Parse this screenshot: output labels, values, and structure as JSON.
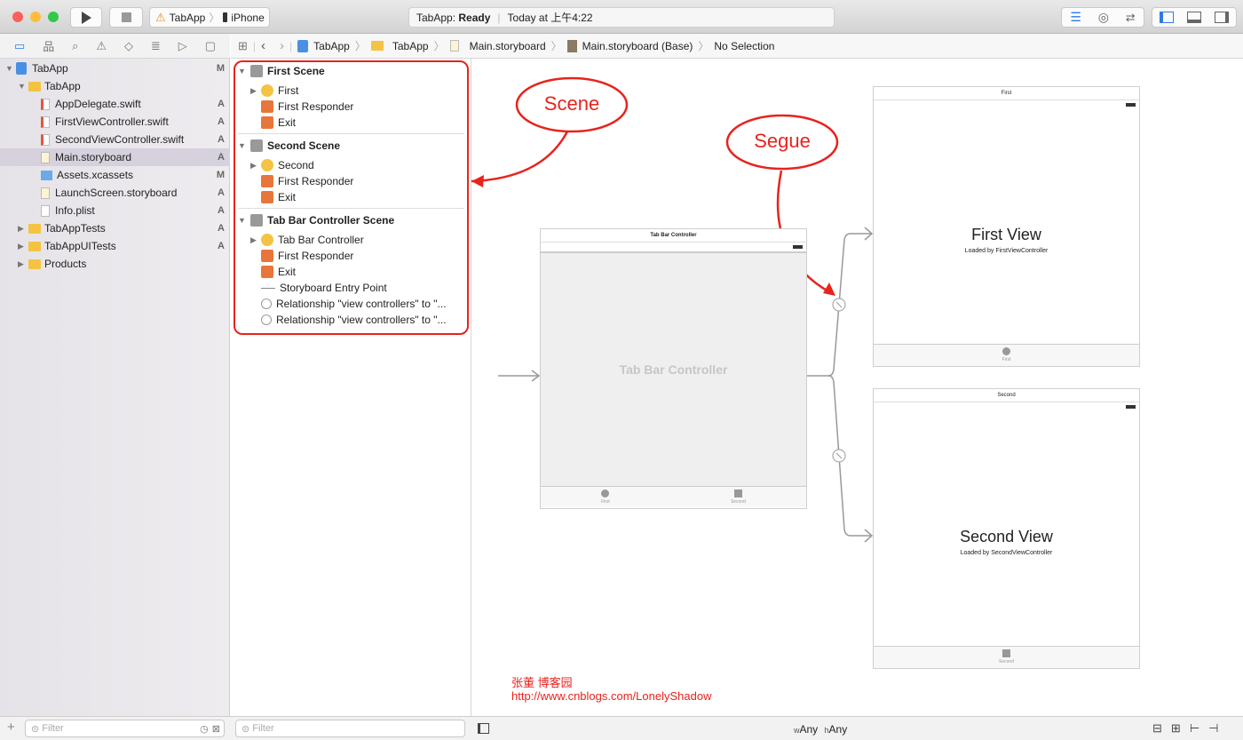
{
  "window": {
    "scheme_app": "TabApp",
    "scheme_device": "iPhone",
    "status_app": "TabApp:",
    "status_state": "Ready",
    "status_time": "Today at 上午4:22"
  },
  "navigator": {
    "tree": [
      {
        "label": "TabApp",
        "status": "M",
        "level": 0,
        "kind": "project",
        "open": true
      },
      {
        "label": "TabApp",
        "status": "",
        "level": 1,
        "kind": "folder",
        "open": true
      },
      {
        "label": "AppDelegate.swift",
        "status": "A",
        "level": 2,
        "kind": "swift"
      },
      {
        "label": "FirstViewController.swift",
        "status": "A",
        "level": 2,
        "kind": "swift"
      },
      {
        "label": "SecondViewController.swift",
        "status": "A",
        "level": 2,
        "kind": "swift"
      },
      {
        "label": "Main.storyboard",
        "status": "A",
        "level": 2,
        "kind": "storyboard",
        "selected": true
      },
      {
        "label": "Assets.xcassets",
        "status": "M",
        "level": 2,
        "kind": "assets"
      },
      {
        "label": "LaunchScreen.storyboard",
        "status": "A",
        "level": 2,
        "kind": "storyboard"
      },
      {
        "label": "Info.plist",
        "status": "A",
        "level": 2,
        "kind": "plist"
      },
      {
        "label": "TabAppTests",
        "status": "A",
        "level": 1,
        "kind": "folder",
        "open": false
      },
      {
        "label": "TabAppUITests",
        "status": "A",
        "level": 1,
        "kind": "folder",
        "open": false
      },
      {
        "label": "Products",
        "status": "",
        "level": 1,
        "kind": "folder",
        "open": false
      }
    ],
    "filter_placeholder": "Filter"
  },
  "jumpbar": [
    "TabApp",
    "TabApp",
    "Main.storyboard",
    "Main.storyboard (Base)",
    "No Selection"
  ],
  "outline": {
    "scenes": [
      {
        "title": "First Scene",
        "items": [
          {
            "label": "First",
            "icon": "view-controller-icon",
            "expand": true
          },
          {
            "label": "First Responder",
            "icon": "first-responder-icon"
          },
          {
            "label": "Exit",
            "icon": "exit-icon"
          }
        ]
      },
      {
        "title": "Second Scene",
        "items": [
          {
            "label": "Second",
            "icon": "view-controller-icon",
            "expand": true
          },
          {
            "label": "First Responder",
            "icon": "first-responder-icon"
          },
          {
            "label": "Exit",
            "icon": "exit-icon"
          }
        ]
      },
      {
        "title": "Tab Bar Controller Scene",
        "items": [
          {
            "label": "Tab Bar Controller",
            "icon": "tab-bar-controller-icon",
            "expand": true
          },
          {
            "label": "First Responder",
            "icon": "first-responder-icon"
          },
          {
            "label": "Exit",
            "icon": "exit-icon"
          },
          {
            "label": "Storyboard Entry Point",
            "icon": "arrow-icon"
          },
          {
            "label": "Relationship \"view controllers\" to \"...",
            "icon": "relationship-icon"
          },
          {
            "label": "Relationship \"view controllers\" to \"...",
            "icon": "relationship-icon"
          }
        ]
      }
    ],
    "filter_placeholder": "Filter"
  },
  "canvas": {
    "tabbar": {
      "nav_title": "Tab Bar Controller",
      "body": "Tab Bar Controller",
      "tab1": "First",
      "tab2": "Second"
    },
    "first": {
      "nav_title": "First",
      "title": "First View",
      "subtitle": "Loaded by FirstViewController",
      "tab": "First"
    },
    "second": {
      "nav_title": "Second",
      "title": "Second View",
      "subtitle": "Loaded by SecondViewController",
      "tab": "Second"
    },
    "annotations": {
      "scene": "Scene",
      "segue": "Segue",
      "color": "#e8231c"
    },
    "watermark": {
      "line1": "张董 博客园",
      "line2": "http://www.cnblogs.com/LonelyShadow"
    }
  },
  "bottom": {
    "size_class_w": "w",
    "size_class_w_val": "Any",
    "size_class_h": "h",
    "size_class_h_val": "Any"
  }
}
